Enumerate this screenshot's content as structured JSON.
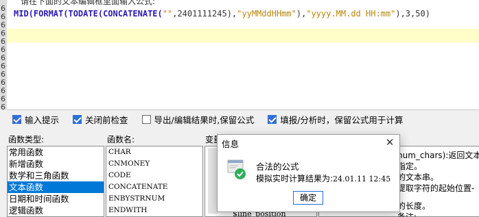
{
  "gutter_marks": [
    "6",
    "6",
    "6",
    "6",
    "6",
    "6",
    "6",
    "6",
    "6",
    "6",
    "6",
    "6",
    "6"
  ],
  "editor": {
    "hint": "请在下面的文本编辑框里面输入公式:",
    "formula_tokens": [
      {
        "t": "fn",
        "v": "MID("
      },
      {
        "t": "fn",
        "v": "FORMAT("
      },
      {
        "t": "fn",
        "v": "TODATE("
      },
      {
        "t": "fn",
        "v": "CONCATENATE("
      },
      {
        "t": "str",
        "v": "\"\""
      },
      {
        "t": "num",
        "v": ",2401111245)"
      },
      {
        "t": "num",
        "v": ","
      },
      {
        "t": "str",
        "v": "\"yyMMddHHmm\""
      },
      {
        "t": "num",
        "v": "),"
      },
      {
        "t": "str",
        "v": "\"yyyy.MM.dd HH:mm\""
      },
      {
        "t": "num",
        "v": "),3,50)"
      }
    ]
  },
  "options": [
    {
      "label": "输入提示",
      "checked": true
    },
    {
      "label": "关闭前检查",
      "checked": true
    },
    {
      "label": "导出/编辑结果时,保留公式",
      "checked": false
    },
    {
      "label": "填报/分析时，保留公式用于计算",
      "checked": true
    }
  ],
  "panels": {
    "category_label": "函数类型:",
    "name_label": "函数名:",
    "var_label": "变量",
    "categories": [
      "常用函数",
      "新增函数",
      "数学和三角函数",
      "文本函数",
      "日期和时间函数",
      "逻辑函数"
    ],
    "selected_category": 3,
    "functions": [
      "CHAR",
      "CNMONEY",
      "CODE",
      "CONCATENATE",
      "ENBYSTRNUM",
      "ENDWITH"
    ],
    "desc_lines": [
      "num_chars):返回文本",
      "指定。",
      "的文本串。",
      "提取字符的起始位置-",
      "的长度。",
      "备注:"
    ],
    "var_partial": "$line_position"
  },
  "dialog": {
    "title": "信息",
    "close": "✕",
    "message": "合法的公式",
    "result_label": "模拟实时计算结果为:",
    "result_value": "24.01.11 12:45",
    "ok": "确定"
  },
  "colors": {
    "selection": "#0078d7",
    "checkbox": "#2f6fd6",
    "function": "#2a1bb0",
    "string": "#b8860b",
    "success": "#2fae5a"
  }
}
